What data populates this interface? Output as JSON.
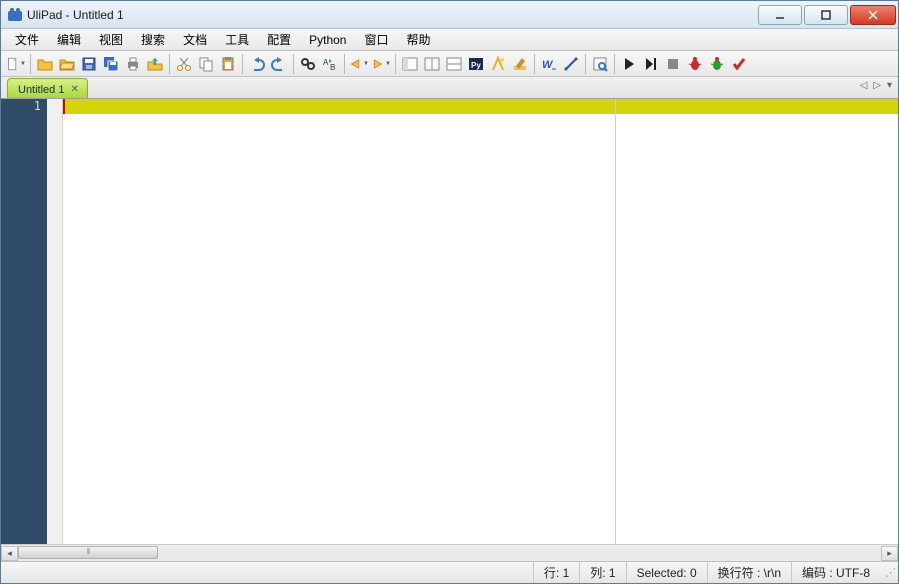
{
  "window": {
    "title": "UliPad - Untitled 1"
  },
  "menu": {
    "file": "文件",
    "edit": "编辑",
    "view": "视图",
    "search": "搜索",
    "document": "文档",
    "tools": "工具",
    "config": "配置",
    "python": "Python",
    "window": "窗口",
    "help": "帮助"
  },
  "toolbar_icons": {
    "new": "new-file",
    "open": "open-file",
    "open_project": "open-project",
    "save": "save",
    "save_all": "save-all",
    "print": "print",
    "upload": "upload",
    "cut": "cut",
    "copy": "copy",
    "paste": "paste",
    "undo": "undo",
    "redo": "redo",
    "find": "find",
    "replace": "replace",
    "back": "nav-back",
    "forward": "nav-forward",
    "window1": "toggle-sidebar",
    "window2": "split-h",
    "window3": "split-v",
    "pylogo": "python-console",
    "wand": "validate",
    "brush": "format",
    "word_wrap": "word-wrap",
    "ruler": "ruler",
    "preview": "preview",
    "run": "run",
    "run_active": "run-selection",
    "stop": "stop",
    "bug_red": "bug",
    "bug_green": "bug2",
    "check": "syntax-check"
  },
  "tab": {
    "label": "Untitled 1"
  },
  "editor": {
    "line_number": "1"
  },
  "status": {
    "line_label": "行: 1",
    "col_label": "列: 1",
    "selected_label": "Selected: 0",
    "eol_label": "换行符 : \\r\\n",
    "encoding_label": "编码 : UTF-8"
  }
}
